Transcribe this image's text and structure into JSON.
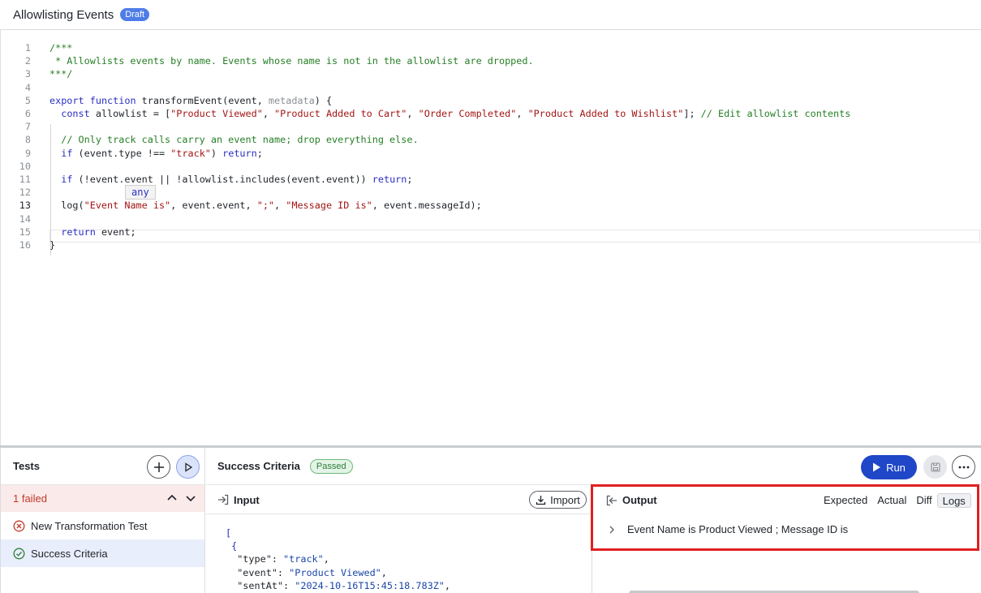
{
  "header": {
    "title": "Allowlisting Events",
    "badge": "Draft"
  },
  "editor": {
    "lines": [
      {
        "n": "1",
        "parts": [
          {
            "t": "/***",
            "c": "c-com"
          }
        ]
      },
      {
        "n": "2",
        "parts": [
          {
            "t": " * Allowlists events by name. Events whose name is not in the allowlist are dropped.",
            "c": "c-com"
          }
        ]
      },
      {
        "n": "3",
        "parts": [
          {
            "t": "***/",
            "c": "c-com"
          }
        ]
      },
      {
        "n": "4",
        "parts": []
      },
      {
        "n": "5",
        "parts": [
          {
            "t": "export",
            "c": "c-kw"
          },
          {
            "t": " ",
            "c": ""
          },
          {
            "t": "function",
            "c": "c-kw"
          },
          {
            "t": " transformEvent(event, ",
            "c": ""
          },
          {
            "t": "metadata",
            "c": "c-param"
          },
          {
            "t": ") {",
            "c": ""
          }
        ]
      },
      {
        "n": "6",
        "parts": [
          {
            "t": "  ",
            "c": ""
          },
          {
            "t": "const",
            "c": "c-kw"
          },
          {
            "t": " allowlist = [",
            "c": ""
          },
          {
            "t": "\"Product Viewed\"",
            "c": "c-str"
          },
          {
            "t": ", ",
            "c": ""
          },
          {
            "t": "\"Product Added to Cart\"",
            "c": "c-str"
          },
          {
            "t": ", ",
            "c": ""
          },
          {
            "t": "\"Order Completed\"",
            "c": "c-str"
          },
          {
            "t": ", ",
            "c": ""
          },
          {
            "t": "\"Product Added to Wishlist\"",
            "c": "c-str"
          },
          {
            "t": "]; ",
            "c": ""
          },
          {
            "t": "// Edit allowlist contents",
            "c": "c-com"
          }
        ]
      },
      {
        "n": "7",
        "parts": []
      },
      {
        "n": "8",
        "parts": [
          {
            "t": "  ",
            "c": ""
          },
          {
            "t": "// Only track calls carry an event name; drop everything else.",
            "c": "c-com"
          }
        ]
      },
      {
        "n": "9",
        "parts": [
          {
            "t": "  ",
            "c": ""
          },
          {
            "t": "if",
            "c": "c-kw"
          },
          {
            "t": " (event.type !== ",
            "c": ""
          },
          {
            "t": "\"track\"",
            "c": "c-str"
          },
          {
            "t": ") ",
            "c": ""
          },
          {
            "t": "return",
            "c": "c-kw"
          },
          {
            "t": ";",
            "c": ""
          }
        ]
      },
      {
        "n": "10",
        "parts": []
      },
      {
        "n": "11",
        "parts": [
          {
            "t": "  ",
            "c": ""
          },
          {
            "t": "if",
            "c": "c-kw"
          },
          {
            "t": " (!event.event || !allowlist.includes(event.event)) ",
            "c": ""
          },
          {
            "t": "return",
            "c": "c-kw"
          },
          {
            "t": ";",
            "c": ""
          }
        ]
      },
      {
        "n": "12",
        "parts": []
      },
      {
        "n": "13",
        "parts": [
          {
            "t": "  log(",
            "c": ""
          },
          {
            "t": "\"Event Name is\"",
            "c": "c-str"
          },
          {
            "t": ", event.event, ",
            "c": ""
          },
          {
            "t": "\";\"",
            "c": "c-str"
          },
          {
            "t": ", ",
            "c": ""
          },
          {
            "t": "\"Message ID is\"",
            "c": "c-str"
          },
          {
            "t": ", event.messageId);",
            "c": ""
          }
        ]
      },
      {
        "n": "14",
        "parts": []
      },
      {
        "n": "15",
        "parts": [
          {
            "t": "  ",
            "c": ""
          },
          {
            "t": "return",
            "c": "c-kw"
          },
          {
            "t": " event;",
            "c": ""
          }
        ]
      },
      {
        "n": "16",
        "parts": [
          {
            "t": "}",
            "c": ""
          }
        ]
      }
    ],
    "active_line": "13",
    "tooltip": "any"
  },
  "tests": {
    "title": "Tests",
    "failed_summary": "1 failed",
    "items": [
      {
        "label": "New Transformation Test",
        "status": "failed"
      },
      {
        "label": "Success Criteria",
        "status": "passed"
      }
    ]
  },
  "criteria": {
    "title": "Success Criteria",
    "badge": "Passed",
    "run_label": "Run"
  },
  "input": {
    "label": "Input",
    "import_label": "Import",
    "json_lines": [
      {
        "parts": [
          {
            "t": "[",
            "c": "j-brk"
          }
        ]
      },
      {
        "parts": [
          {
            "t": " {",
            "c": "j-brk"
          }
        ]
      },
      {
        "parts": [
          {
            "t": "  \"type\": ",
            "c": "j-key"
          },
          {
            "t": "\"track\"",
            "c": "j-str"
          },
          {
            "t": ",",
            "c": "j-key"
          }
        ]
      },
      {
        "parts": [
          {
            "t": "  \"event\": ",
            "c": "j-key"
          },
          {
            "t": "\"Product Viewed\"",
            "c": "j-str"
          },
          {
            "t": ",",
            "c": "j-key"
          }
        ]
      },
      {
        "parts": [
          {
            "t": "  \"sentAt\": ",
            "c": "j-key"
          },
          {
            "t": "\"2024-10-16T15:45:18.783Z\"",
            "c": "j-str"
          },
          {
            "t": ",",
            "c": "j-key"
          }
        ]
      }
    ]
  },
  "output": {
    "label": "Output",
    "tabs": [
      "Expected",
      "Actual",
      "Diff",
      "Logs"
    ],
    "active_tab": "Logs",
    "log_text": "Event Name is Product Viewed ; Message ID is"
  }
}
